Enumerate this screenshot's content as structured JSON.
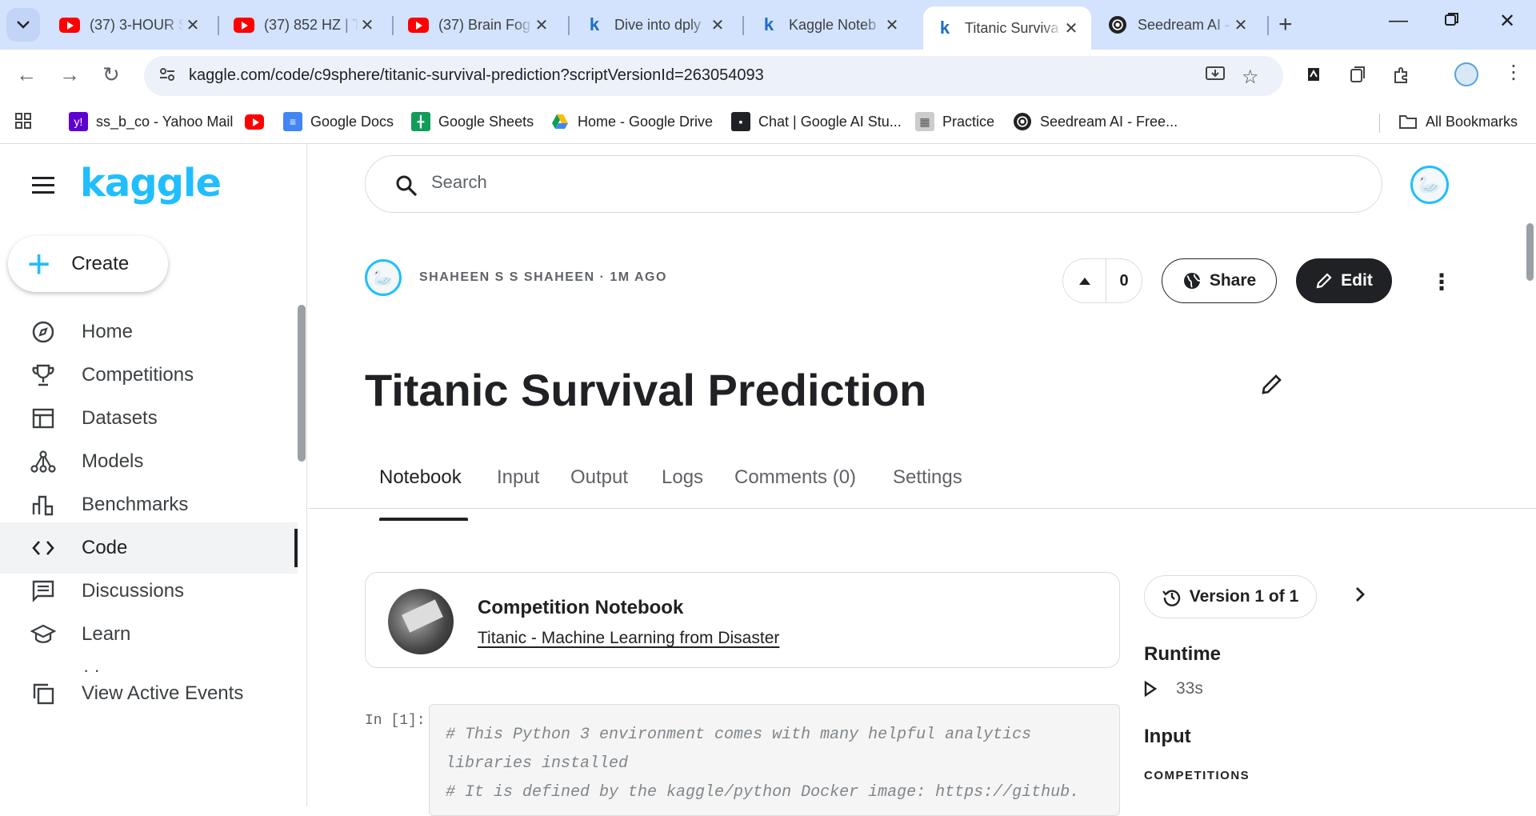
{
  "browser": {
    "tabs": [
      {
        "title": "(37) 3-HOUR S",
        "favicon": "youtube-icon"
      },
      {
        "title": "(37) 852 HZ | T",
        "favicon": "youtube-icon"
      },
      {
        "title": "(37) Brain Fog",
        "favicon": "youtube-icon"
      },
      {
        "title": "Dive into dply",
        "favicon": "kaggle-icon"
      },
      {
        "title": "Kaggle Noteb",
        "favicon": "kaggle-icon"
      },
      {
        "title": "Titanic Surviva",
        "favicon": "kaggle-icon",
        "active": true
      },
      {
        "title": "Seedream AI -",
        "favicon": "seedream-icon"
      }
    ],
    "url": "kaggle.com/code/c9sphere/titanic-survival-prediction?scriptVersionId=263054093",
    "bookmarks": [
      {
        "label": "ss_b_co - Yahoo Mail",
        "icon": "yahoo-icon"
      },
      {
        "label": "",
        "icon": "youtube-icon"
      },
      {
        "label": "Google Docs",
        "icon": "docs-icon"
      },
      {
        "label": "Google Sheets",
        "icon": "sheets-icon"
      },
      {
        "label": "Home - Google Drive",
        "icon": "drive-icon"
      },
      {
        "label": "Chat | Google AI Stu...",
        "icon": "ai-studio-icon"
      },
      {
        "label": "Practice",
        "icon": "practice-icon"
      },
      {
        "label": "Seedream AI - Free...",
        "icon": "seedream-icon"
      }
    ],
    "all_bookmarks": "All Bookmarks"
  },
  "kaggle": {
    "logo": "kaggle",
    "create_label": "Create",
    "nav": [
      {
        "label": "Home",
        "icon": "compass-icon"
      },
      {
        "label": "Competitions",
        "icon": "trophy-icon"
      },
      {
        "label": "Datasets",
        "icon": "table-icon"
      },
      {
        "label": "Models",
        "icon": "models-icon"
      },
      {
        "label": "Benchmarks",
        "icon": "bar-chart-icon"
      },
      {
        "label": "Code",
        "icon": "code-icon",
        "active": true
      },
      {
        "label": "Discussions",
        "icon": "discussion-icon"
      },
      {
        "label": "Learn",
        "icon": "graduation-cap-icon"
      },
      {
        "label": "View Active Events",
        "icon": "copy-icon"
      }
    ],
    "search_placeholder": "Search",
    "author_line": "SHAHEEN S S SHAHEEN · 1M AGO",
    "vote_count": "0",
    "share_label": "Share",
    "edit_label": "Edit",
    "title": "Titanic Survival Prediction",
    "tabs": [
      "Notebook",
      "Input",
      "Output",
      "Logs",
      "Comments (0)",
      "Settings"
    ],
    "active_tab": "Notebook",
    "competition_card": {
      "heading": "Competition Notebook",
      "link": "Titanic - Machine Learning from Disaster"
    },
    "cell": {
      "label": "In [1]:",
      "code": "# This Python 3 environment comes with many helpful analytics libraries installed\n# It is defined by the kaggle/python Docker image: https://github."
    },
    "version_label": "Version 1 of 1",
    "runtime_heading": "Runtime",
    "runtime_value": "33s",
    "input_heading": "Input",
    "competitions_caption": "COMPETITIONS"
  },
  "colors": {
    "kaggle_blue": "#20beff",
    "tab_strip": "#d3e3fd",
    "dark_button": "#202124"
  }
}
